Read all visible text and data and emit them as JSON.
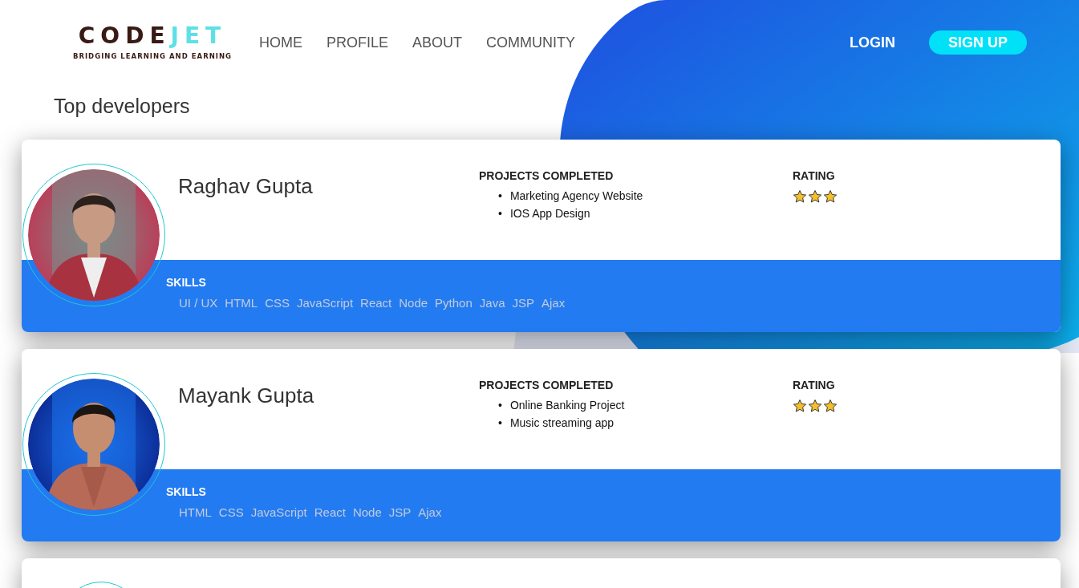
{
  "logo": {
    "words": [
      "CODE",
      "JET"
    ],
    "tagline": "BRIDGING LEARNING AND EARNING"
  },
  "nav": [
    "HOME",
    "PROFILE",
    "ABOUT",
    "COMMUNITY"
  ],
  "auth": {
    "login": "LOGIN",
    "signup": "SIGN UP"
  },
  "heading": "Top developers",
  "developers": [
    {
      "name": "Raghav Gupta",
      "projects_label": "PROJECTS COMPLETED",
      "projects": [
        {
          "bullet": "•",
          "text": "Marketing Agency Website"
        },
        {
          "bullet": "•",
          "text": "IOS App Design"
        }
      ],
      "rating_label": "RATING",
      "stars": 3,
      "skills_label": "SKILLS",
      "skills": [
        "UI / UX",
        "HTML",
        "CSS",
        "JavaScript",
        "React",
        "Node",
        "Python",
        "Java",
        "JSP",
        "Ajax"
      ]
    },
    {
      "name": "Mayank Gupta",
      "projects_label": "PROJECTS COMPLETED",
      "projects": [
        {
          "bullet": "•",
          "text": "Online Banking Project"
        },
        {
          "bullet": "•",
          "text": "Music streaming app"
        }
      ],
      "rating_label": "RATING",
      "stars": 3,
      "skills_label": "SKILLS",
      "skills": [
        "HTML",
        "CSS",
        "JavaScript",
        "React",
        "Node",
        "JSP",
        "Ajax"
      ]
    }
  ]
}
